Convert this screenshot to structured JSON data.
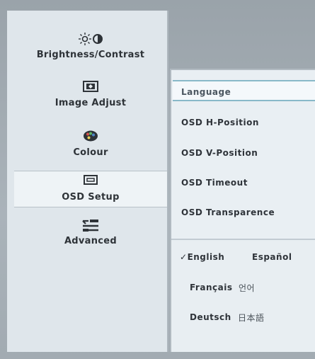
{
  "left_menu": {
    "items": [
      {
        "label": "Brightness/Contrast",
        "icon": "brightness-contrast-icon",
        "selected": false
      },
      {
        "label": "Image Adjust",
        "icon": "image-adjust-icon",
        "selected": false
      },
      {
        "label": "Colour",
        "icon": "colour-icon",
        "selected": false
      },
      {
        "label": "OSD Setup",
        "icon": "osd-setup-icon",
        "selected": true
      },
      {
        "label": "Advanced",
        "icon": "advanced-icon",
        "selected": false
      }
    ]
  },
  "osd_setup": {
    "items": [
      {
        "label": "Language",
        "selected": true
      },
      {
        "label": "OSD H-Position",
        "selected": false
      },
      {
        "label": "OSD V-Position",
        "selected": false
      },
      {
        "label": "OSD Timeout",
        "selected": false
      },
      {
        "label": "OSD Transparence",
        "selected": false
      }
    ]
  },
  "languages": {
    "check_mark": "✓",
    "options": [
      {
        "label": "English",
        "selected": true
      },
      {
        "label": "Español",
        "selected": false
      },
      {
        "label": "Français",
        "selected": false
      },
      {
        "label": "언어",
        "selected": false
      },
      {
        "label": "Deutsch",
        "selected": false
      },
      {
        "label": "日本語",
        "selected": false
      }
    ]
  },
  "colors": {
    "panel": "#e7edf1",
    "selected_border": "#89b9c9",
    "text": "#2f343a"
  }
}
